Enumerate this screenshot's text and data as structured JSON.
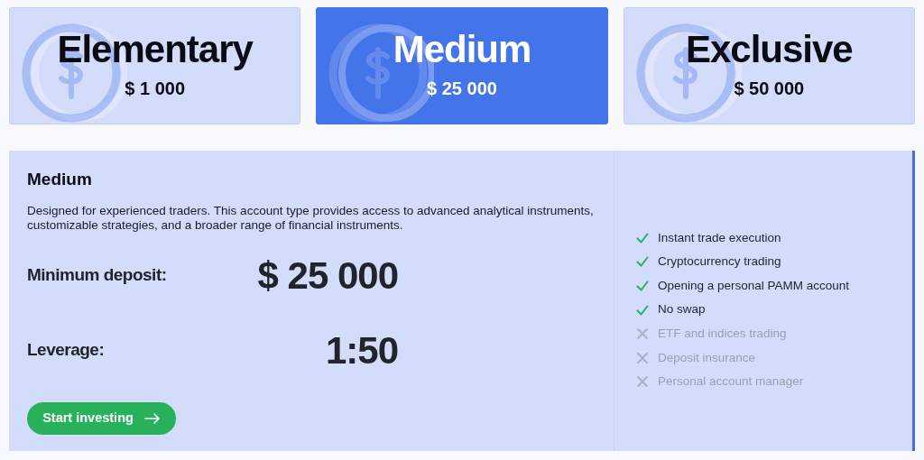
{
  "plans": [
    {
      "name": "Elementary",
      "price": "$ 1 000",
      "selected": false
    },
    {
      "name": "Medium",
      "price": "$ 25 000",
      "selected": true
    },
    {
      "name": "Exclusive",
      "price": "$ 50 000",
      "selected": false
    }
  ],
  "detail": {
    "title": "Medium",
    "description": "Designed for experienced traders. This account type provides access to advanced analytical instruments, customizable strategies, and a broader range of financial instruments.",
    "min_deposit_label": "Minimum deposit:",
    "min_deposit_value": "$ 25 000",
    "leverage_label": "Leverage:",
    "leverage_value": "1:50",
    "button": "Start investing"
  },
  "features": [
    {
      "label": "Instant trade execution",
      "included": true
    },
    {
      "label": "Cryptocurrency trading",
      "included": true
    },
    {
      "label": "Opening a personal PAMM account",
      "included": true
    },
    {
      "label": "No swap",
      "included": true
    },
    {
      "label": "ETF and indices trading",
      "included": false
    },
    {
      "label": "Deposit insurance",
      "included": false
    },
    {
      "label": "Personal account manager",
      "included": false
    }
  ]
}
